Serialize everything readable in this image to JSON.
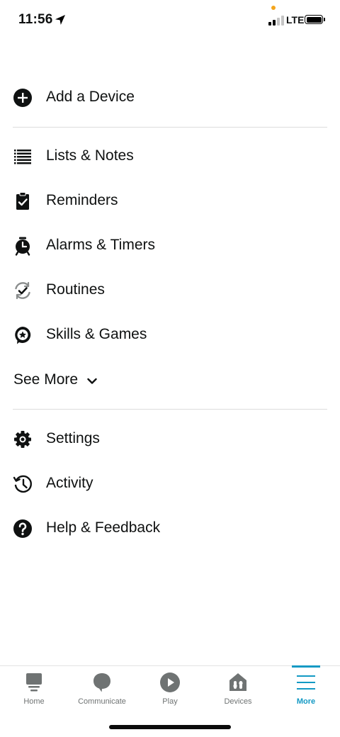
{
  "status_bar": {
    "time": "11:56",
    "network": "LTE"
  },
  "menu": {
    "add_device": "Add a Device",
    "lists_notes": "Lists & Notes",
    "reminders": "Reminders",
    "alarms_timers": "Alarms & Timers",
    "routines": "Routines",
    "skills_games": "Skills & Games",
    "see_more": "See More",
    "settings": "Settings",
    "activity": "Activity",
    "help_feedback": "Help & Feedback"
  },
  "tabs": [
    {
      "label": "Home",
      "icon": "home-icon"
    },
    {
      "label": "Communicate",
      "icon": "chat-bubble-icon"
    },
    {
      "label": "Play",
      "icon": "play-icon"
    },
    {
      "label": "Devices",
      "icon": "devices-icon"
    },
    {
      "label": "More",
      "icon": "hamburger-icon",
      "active": true
    }
  ],
  "colors": {
    "accent": "#1399c4",
    "text": "#0f1111",
    "inactive_tab": "#6f7373"
  }
}
